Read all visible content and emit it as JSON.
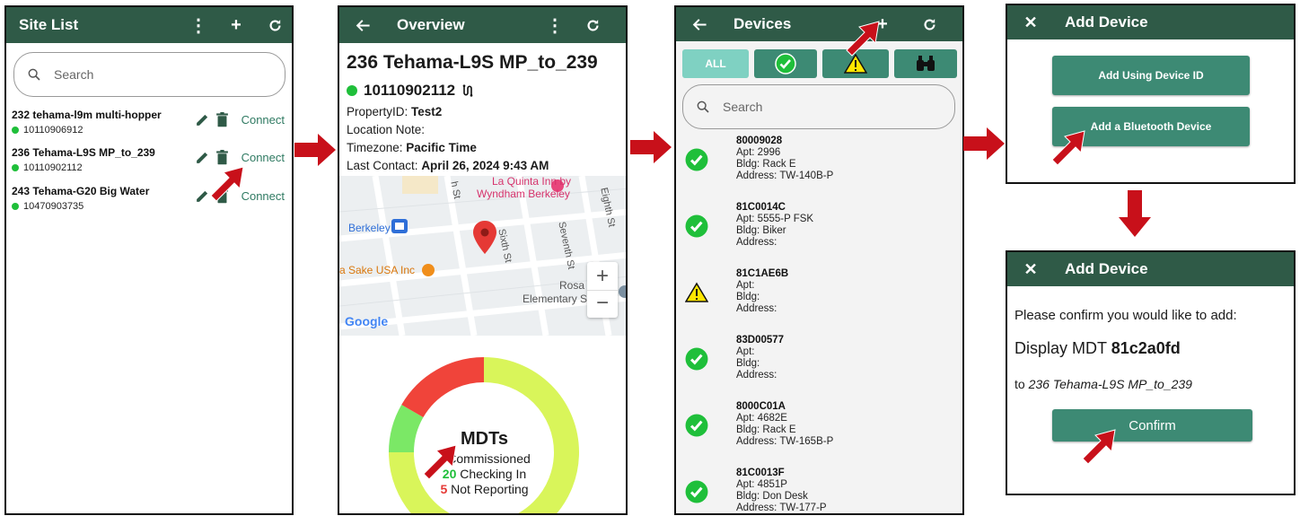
{
  "site_list": {
    "title": "Site List",
    "search_placeholder": "Search",
    "connect_label": "Connect",
    "sites": [
      {
        "name": "232 tehama-l9m multi-hopper",
        "id": "10110906912"
      },
      {
        "name": "236 Tehama-L9S MP_to_239",
        "id": "10110902112"
      },
      {
        "name": "243 Tehama-G20 Big Water",
        "id": "10470903735"
      }
    ]
  },
  "overview": {
    "title": "Overview",
    "site_name": "236 Tehama-L9S MP_to_239",
    "site_id": "10110902112",
    "property_label": "PropertyID:",
    "property_value": "Test2",
    "location_label": "Location Note:",
    "timezone_label": "Timezone:",
    "timezone_value": "Pacific Time",
    "last_contact_label": "Last Contact:",
    "last_contact_value": "April 26, 2024 9:43 AM",
    "map": {
      "poi_hotel_1": "La Quinta Inn by",
      "poi_hotel_2": "Wyndham Berkeley",
      "berkeley": "Berkeley",
      "sake": "ra Sake USA Inc",
      "rosa_1": "Rosa Parks",
      "rosa_2": "Elementary School",
      "sixth": "Sixth St",
      "seventh": "Seventh St",
      "eighth": "Eighth St",
      "fifth": "h St",
      "google": "Google",
      "zoom_in": "+",
      "zoom_out": "−"
    },
    "donut": {
      "title": "MDTs",
      "commissioned_label": "Commissioned",
      "checking_value": "20",
      "checking_label": "Checking In",
      "not_reporting_value": "5",
      "not_reporting_label": "Not Reporting",
      "colors": {
        "red": "#f0443a",
        "yellow": "#d9f55a",
        "green": "#7be866"
      }
    }
  },
  "devices": {
    "title": "Devices",
    "filter_all": "ALL",
    "search_placeholder": "Search",
    "apt_label": "Apt:",
    "bldg_label": "Bldg:",
    "address_label": "Address:",
    "items": [
      {
        "id": "80009028",
        "apt": "2996",
        "bldg": "Rack E",
        "address": "TW-140B-P",
        "status": "ok"
      },
      {
        "id": "81C0014C",
        "apt": "5555-P FSK",
        "bldg": "Biker",
        "address": "",
        "status": "ok"
      },
      {
        "id": "81C1AE6B",
        "apt": "",
        "bldg": "",
        "address": "",
        "status": "warning"
      },
      {
        "id": "83D00577",
        "apt": "",
        "bldg": "",
        "address": "",
        "status": "ok"
      },
      {
        "id": "8000C01A",
        "apt": "4682E",
        "bldg": "Rack E",
        "address": "TW-165B-P",
        "status": "ok"
      },
      {
        "id": "81C0013F",
        "apt": "4851P",
        "bldg": "Don Desk",
        "address": "TW-177-P",
        "status": "ok"
      }
    ]
  },
  "add_device": {
    "title": "Add Device",
    "btn_device_id": "Add Using Device ID",
    "btn_bluetooth": "Add a Bluetooth Device"
  },
  "confirm_dialog": {
    "title": "Add Device",
    "prompt": "Please confirm you would like to add:",
    "device_prefix": "Display MDT",
    "device_id": "81c2a0fd",
    "to_prefix": "to",
    "to_site": "236 Tehama-L9S MP_to_239",
    "confirm_label": "Confirm"
  },
  "colors": {
    "appbar": "#2f5a47",
    "accent": "#3d8a74",
    "status_green": "#1fbf3a",
    "arrow_red": "#c8101a"
  }
}
